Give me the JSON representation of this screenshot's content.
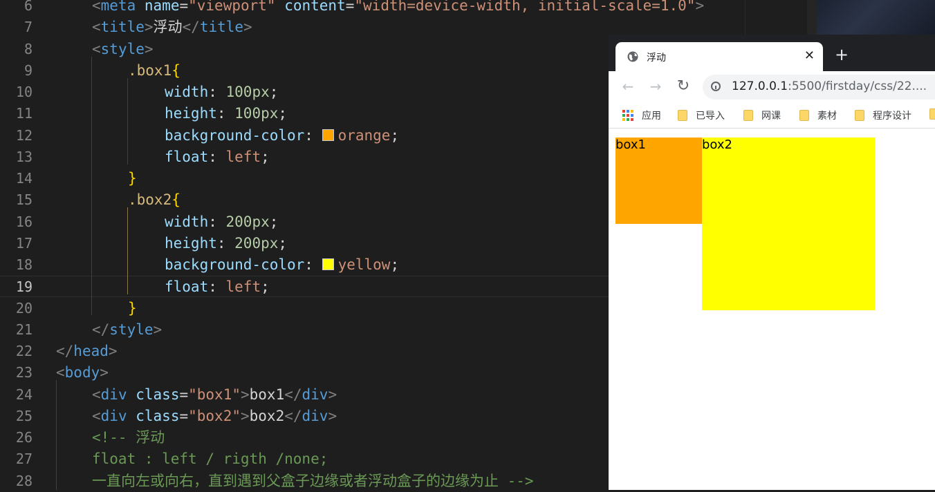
{
  "editor": {
    "lines": [
      {
        "num": "6",
        "tokens": [
          [
            "t-punct",
            "<"
          ],
          [
            "t-tag",
            "meta"
          ],
          [
            "t-text",
            " "
          ],
          [
            "t-attr",
            "name"
          ],
          [
            "t-text",
            "="
          ],
          [
            "t-str",
            "\"viewport\""
          ],
          [
            "t-text",
            " "
          ],
          [
            "t-attr",
            "content"
          ],
          [
            "t-text",
            "="
          ],
          [
            "t-str",
            "\"width=device-width, initial-scale=1.0\""
          ],
          [
            "t-punct",
            ">"
          ]
        ]
      },
      {
        "num": "7",
        "tokens": [
          [
            "t-punct",
            "<"
          ],
          [
            "t-tag",
            "title"
          ],
          [
            "t-punct",
            ">"
          ],
          [
            "t-text",
            "浮动"
          ],
          [
            "t-punct",
            "</"
          ],
          [
            "t-tag",
            "title"
          ],
          [
            "t-punct",
            ">"
          ]
        ]
      },
      {
        "num": "8",
        "tokens": [
          [
            "t-punct",
            "<"
          ],
          [
            "t-tag",
            "style"
          ],
          [
            "t-punct",
            ">"
          ]
        ]
      },
      {
        "num": "9",
        "tokens": [
          [
            "t-sel",
            ".box1"
          ],
          [
            "t-brace",
            "{"
          ]
        ]
      },
      {
        "num": "10",
        "tokens": [
          [
            "t-prop",
            "width"
          ],
          [
            "t-text",
            ": "
          ],
          [
            "t-num",
            "100px"
          ],
          [
            "t-text",
            ";"
          ]
        ]
      },
      {
        "num": "11",
        "tokens": [
          [
            "t-prop",
            "height"
          ],
          [
            "t-text",
            ": "
          ],
          [
            "t-num",
            "100px"
          ],
          [
            "t-text",
            ";"
          ]
        ]
      },
      {
        "num": "12",
        "tokens": [
          [
            "t-prop",
            "background-color"
          ],
          [
            "t-text",
            ": "
          ],
          [
            "swatch",
            "#ffa500"
          ],
          [
            "t-val",
            "orange"
          ],
          [
            "t-text",
            ";"
          ]
        ]
      },
      {
        "num": "13",
        "tokens": [
          [
            "t-prop",
            "float"
          ],
          [
            "t-text",
            ": "
          ],
          [
            "t-val",
            "left"
          ],
          [
            "t-text",
            ";"
          ]
        ]
      },
      {
        "num": "14",
        "tokens": [
          [
            "t-brace",
            "}"
          ]
        ]
      },
      {
        "num": "15",
        "tokens": [
          [
            "t-sel",
            ".box2"
          ],
          [
            "t-brace",
            "{"
          ]
        ]
      },
      {
        "num": "16",
        "tokens": [
          [
            "t-prop",
            "width"
          ],
          [
            "t-text",
            ": "
          ],
          [
            "t-num",
            "200px"
          ],
          [
            "t-text",
            ";"
          ]
        ]
      },
      {
        "num": "17",
        "tokens": [
          [
            "t-prop",
            "height"
          ],
          [
            "t-text",
            ": "
          ],
          [
            "t-num",
            "200px"
          ],
          [
            "t-text",
            ";"
          ]
        ]
      },
      {
        "num": "18",
        "tokens": [
          [
            "t-prop",
            "background-color"
          ],
          [
            "t-text",
            ": "
          ],
          [
            "swatch",
            "#ffff00"
          ],
          [
            "t-val",
            "yellow"
          ],
          [
            "t-text",
            ";"
          ]
        ]
      },
      {
        "num": "19",
        "tokens": [
          [
            "t-prop",
            "float"
          ],
          [
            "t-text",
            ": "
          ],
          [
            "t-val",
            "left"
          ],
          [
            "t-text",
            ";"
          ]
        ]
      },
      {
        "num": "20",
        "tokens": [
          [
            "t-brace",
            "}"
          ]
        ]
      },
      {
        "num": "21",
        "tokens": [
          [
            "t-punct",
            "</"
          ],
          [
            "t-tag",
            "style"
          ],
          [
            "t-punct",
            ">"
          ]
        ]
      },
      {
        "num": "22",
        "tokens": [
          [
            "t-punct",
            "</"
          ],
          [
            "t-tag",
            "head"
          ],
          [
            "t-punct",
            ">"
          ]
        ]
      },
      {
        "num": "23",
        "tokens": [
          [
            "t-punct",
            "<"
          ],
          [
            "t-tag",
            "body"
          ],
          [
            "t-punct",
            ">"
          ]
        ]
      },
      {
        "num": "24",
        "tokens": [
          [
            "t-punct",
            "<"
          ],
          [
            "t-tag",
            "div"
          ],
          [
            "t-text",
            " "
          ],
          [
            "t-attr",
            "class"
          ],
          [
            "t-text",
            "="
          ],
          [
            "t-str",
            "\"box1\""
          ],
          [
            "t-punct",
            ">"
          ],
          [
            "t-text",
            "box1"
          ],
          [
            "t-punct",
            "</"
          ],
          [
            "t-tag",
            "div"
          ],
          [
            "t-punct",
            ">"
          ]
        ]
      },
      {
        "num": "25",
        "tokens": [
          [
            "t-punct",
            "<"
          ],
          [
            "t-tag",
            "div"
          ],
          [
            "t-text",
            " "
          ],
          [
            "t-attr",
            "class"
          ],
          [
            "t-text",
            "="
          ],
          [
            "t-str",
            "\"box2\""
          ],
          [
            "t-punct",
            ">"
          ],
          [
            "t-text",
            "box2"
          ],
          [
            "t-punct",
            "</"
          ],
          [
            "t-tag",
            "div"
          ],
          [
            "t-punct",
            ">"
          ]
        ]
      },
      {
        "num": "26",
        "tokens": [
          [
            "t-cmt",
            "<!-- 浮动"
          ]
        ]
      },
      {
        "num": "27",
        "tokens": [
          [
            "t-cmt",
            "float : left / rigth /none;"
          ]
        ]
      },
      {
        "num": "28",
        "tokens": [
          [
            "t-cmt",
            "一直向左或向右，直到遇到父盒子边缘或者浮动盒子的边缘为止 -->"
          ]
        ]
      }
    ],
    "current_line": "19"
  },
  "browser": {
    "tab_title": "浮动",
    "tab_close": "✕",
    "new_tab": "+",
    "back": "←",
    "forward": "→",
    "reload": "↻",
    "url_host": "127.0.0.1",
    "url_rest": ":5500/firstday/css/22....",
    "bookmarks": [
      "应用",
      "已导入",
      "网课",
      "素材",
      "程序设计"
    ],
    "page": {
      "box1_text": "box1",
      "box1_color": "#ffa500",
      "box2_text": "box2",
      "box2_color": "#ffff00"
    }
  }
}
